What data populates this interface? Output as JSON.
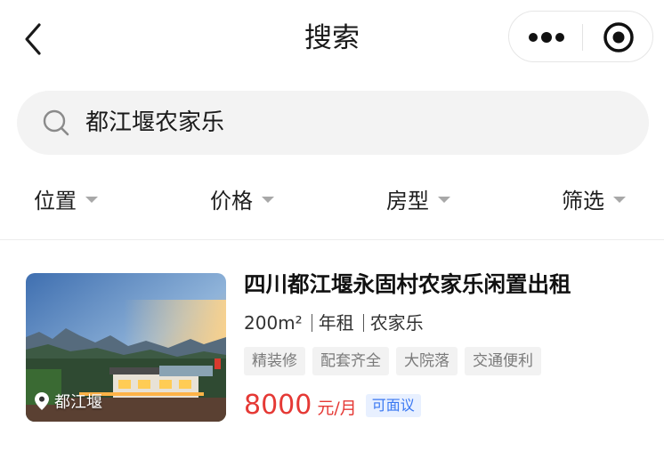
{
  "nav": {
    "title": "搜索",
    "back_icon": "chevron-left-icon",
    "more_icon": "more-dots-icon",
    "close_icon": "target-close-icon"
  },
  "search": {
    "value": "都江堰农家乐",
    "icon": "search-icon"
  },
  "filters": [
    {
      "label": "位置"
    },
    {
      "label": "价格"
    },
    {
      "label": "房型"
    },
    {
      "label": "筛选"
    }
  ],
  "listing": {
    "title": "四川都江堰永固村农家乐闲置出租",
    "area": "200m²",
    "lease": "年租",
    "type": "农家乐",
    "tags": [
      "精装修",
      "配套齐全",
      "大院落",
      "交通便利"
    ],
    "price": "8000",
    "price_unit": "元/月",
    "negotiable": "可面议",
    "location": "都江堰",
    "location_icon": "location-pin-icon"
  },
  "colors": {
    "price": "#e53935",
    "negotiable_bg": "#e8f0ff",
    "negotiable_text": "#3a78f2",
    "search_bg": "#f3f3f3"
  }
}
